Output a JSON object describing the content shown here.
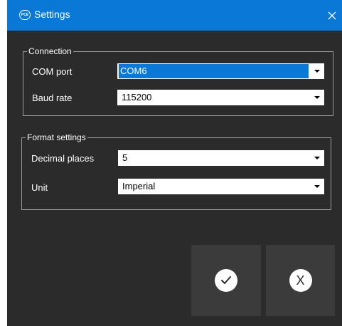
{
  "window": {
    "title": "Settings",
    "logo_text": "PCE",
    "close_icon": "close-icon"
  },
  "connection": {
    "legend": "Connection",
    "com_port": {
      "label": "COM port",
      "value": "COM6"
    },
    "baud_rate": {
      "label": "Baud rate",
      "value": "115200"
    }
  },
  "format": {
    "legend": "Format settings",
    "decimal_places": {
      "label": "Decimal places",
      "value": "5"
    },
    "unit": {
      "label": "Unit",
      "value": "Imperial"
    }
  },
  "actions": {
    "confirm_icon": "checkmark-icon",
    "cancel_label": "X"
  },
  "colors": {
    "titlebar": "#0a78d7",
    "background": "#2b2b2b",
    "button_bg": "#3b3b3b",
    "selection": "#0a78d7"
  }
}
